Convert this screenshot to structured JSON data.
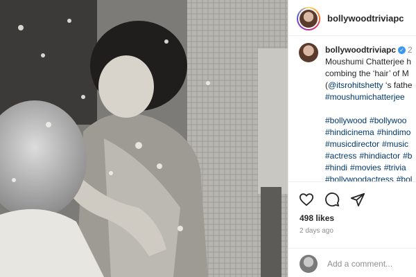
{
  "post": {
    "username": "bollywoodtriviapc",
    "verified_mark": "✓",
    "age_short": "2",
    "caption_lines": [
      "Moushumi Chatterjee h",
      "combing the ‘hair’ of M"
    ],
    "mention_line_prefix": "(",
    "mention": "@itsrohitshetty",
    "mention_suffix": " ‘s fathe",
    "caption_hashtag": "#moushumichatterjee",
    "hashtag_rows": [
      [
        "#bollywood",
        "#bollywoo"
      ],
      [
        "#hindicinema",
        "#hindimo"
      ],
      [
        "#musicdirector",
        "#music"
      ],
      [
        "#actress",
        "#hindiactor",
        "#b"
      ],
      [
        "#hindi",
        "#movies",
        "#trivia"
      ],
      [
        "#bollywoodactress",
        "#bol"
      ]
    ],
    "likes": "498 likes",
    "time_ago": "2 days ago"
  },
  "comment": {
    "placeholder": "Add a comment..."
  },
  "icons": {
    "like": "heart-icon",
    "comment": "comment-icon",
    "share": "share-icon",
    "verified": "verified-badge-icon"
  },
  "colors": {
    "link": "#00376b",
    "verified": "#3897f0",
    "muted": "#8e8e8e"
  }
}
